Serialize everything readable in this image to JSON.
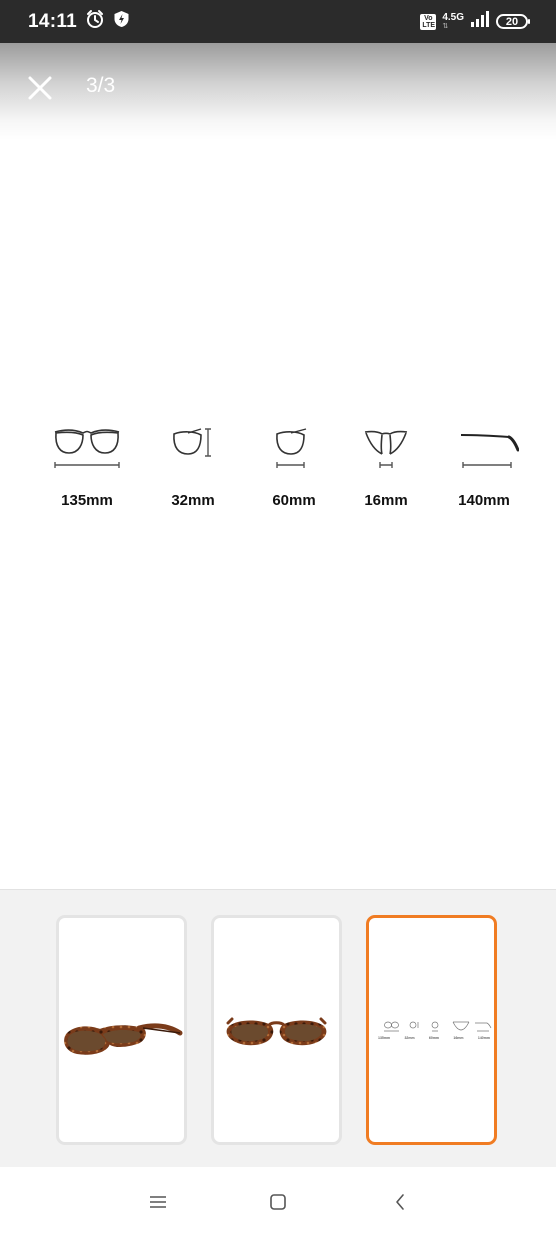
{
  "status_bar": {
    "time": "14:11",
    "left_icons": [
      "alarm-icon",
      "shield-icon"
    ],
    "volte_label": "Vo LTE",
    "network_label": "4.5G",
    "signal_icon": "signal-bars-icon",
    "battery_level": "20"
  },
  "viewer": {
    "close_icon": "close-icon",
    "page_indicator": "3/3"
  },
  "measurements": [
    {
      "icon": "frame-width-icon",
      "label": "135mm"
    },
    {
      "icon": "lens-height-icon",
      "label": "32mm"
    },
    {
      "icon": "lens-width-icon",
      "label": "60mm"
    },
    {
      "icon": "bridge-width-icon",
      "label": "16mm"
    },
    {
      "icon": "temple-length-icon",
      "label": "140mm"
    }
  ],
  "thumbnails": [
    {
      "name": "tortoise-sunglasses-side-view",
      "selected": false
    },
    {
      "name": "tortoise-sunglasses-front-view",
      "selected": false
    },
    {
      "name": "size-chart",
      "selected": true,
      "mini_labels": [
        "135mm",
        "32mm",
        "60mm",
        "16mm",
        "140mm"
      ]
    }
  ],
  "colors": {
    "status_bar_bg": "#2b2b2b",
    "accent_selected": "#f07c23",
    "thumb_strip_bg": "#f2f2f2",
    "tortoise_frame": "#7a3b1a",
    "lens_brown": "#6b4a2e"
  },
  "nav_bar": {
    "recents_icon": "menu-icon",
    "home_icon": "home-icon",
    "back_icon": "back-icon"
  }
}
